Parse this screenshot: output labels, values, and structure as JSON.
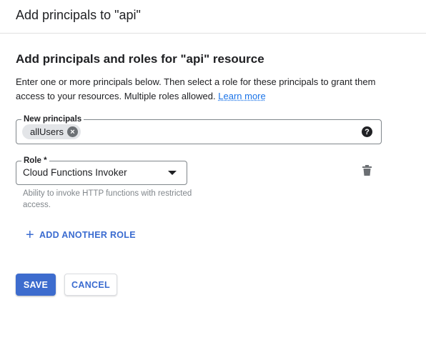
{
  "header": {
    "title": "Add principals to \"api\""
  },
  "section": {
    "heading": "Add principals and roles for \"api\" resource",
    "description": "Enter one or more principals below. Then select a role for these principals to grant them access to your resources. Multiple roles allowed.",
    "learn_more": "Learn more"
  },
  "principals": {
    "label": "New principals",
    "chips": [
      "allUsers"
    ],
    "help_icon": "?"
  },
  "role": {
    "label": "Role *",
    "value": "Cloud Functions Invoker",
    "helper": "Ability to invoke HTTP functions with restricted access."
  },
  "actions": {
    "add_role": "ADD ANOTHER ROLE",
    "save": "SAVE",
    "cancel": "CANCEL"
  },
  "colors": {
    "primary": "#3d6cce",
    "link": "#1a73e8"
  }
}
